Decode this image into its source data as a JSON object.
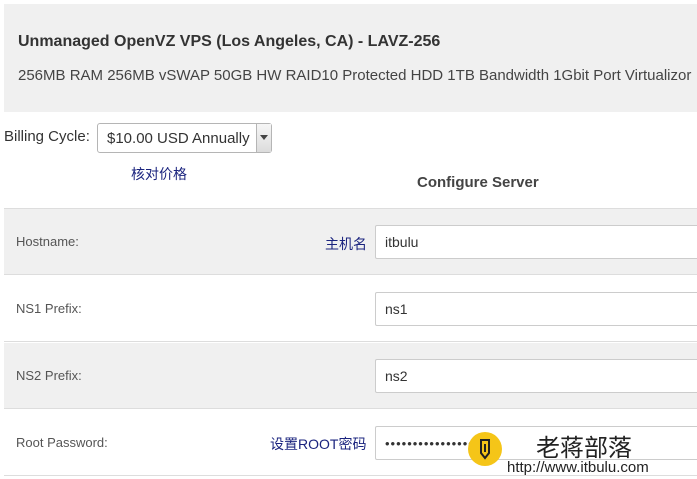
{
  "product": {
    "title": "Unmanaged OpenVZ VPS (Los Angeles, CA) - LAVZ-256",
    "description": "256MB RAM 256MB vSWAP 50GB HW RAID10 Protected HDD 1TB Bandwidth 1Gbit Port Virtualizor"
  },
  "billing": {
    "label": "Billing Cycle:",
    "selected": "$10.00 USD Annually",
    "note": "核对价格"
  },
  "configure": {
    "title": "Configure Server",
    "fields": [
      {
        "label": "Hostname:",
        "value": "itbulu",
        "note": "主机名"
      },
      {
        "label": "NS1 Prefix:",
        "value": "ns1"
      },
      {
        "label": "NS2 Prefix:",
        "value": "ns2"
      },
      {
        "label": "Root Password:",
        "value": "••••••••••••••••",
        "note": "设置ROOT密码"
      }
    ]
  },
  "watermark": {
    "name": "老蒋部落",
    "url": "http://www.itbulu.com"
  },
  "colors": {
    "accent_note": "#1a237e",
    "panel_bg": "#f0f0f0",
    "logo": "#f5c518"
  },
  "icons": {
    "select_arrow": "chevron-down-icon",
    "logo": "pen-logo-icon"
  }
}
